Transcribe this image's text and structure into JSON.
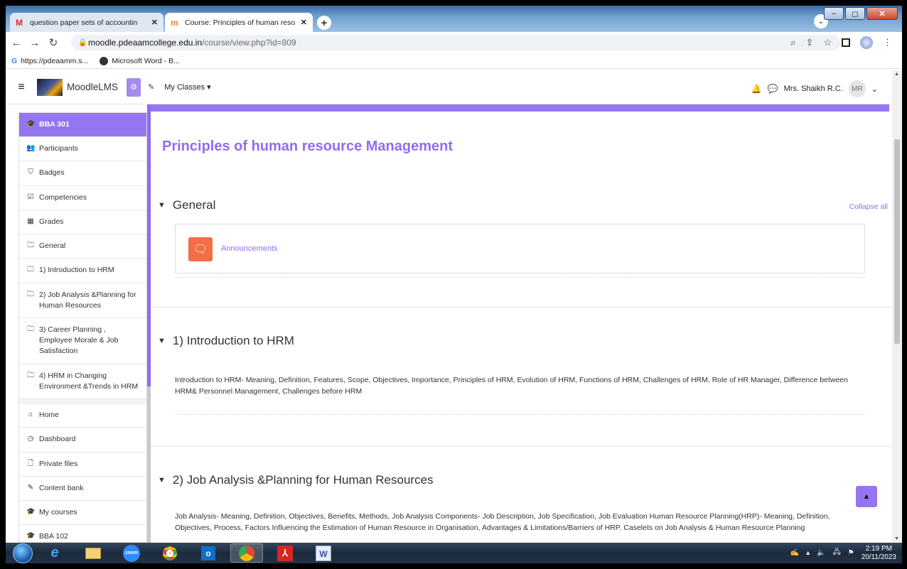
{
  "browser": {
    "tabs": [
      {
        "favicon": "gmail-icon",
        "title": "question paper sets of accountin"
      },
      {
        "favicon": "moodle-icon",
        "title": "Course: Principles of human reso"
      }
    ],
    "new_tab_label": "+",
    "close_glyph": "✕",
    "url_domain": "moodle.pdeaamcollege.edu.in",
    "url_path": "/course/view.php?id=809",
    "bookmarks": [
      {
        "icon": "google-icon",
        "label": "https://pdeaamm.s..."
      },
      {
        "icon": "web-icon",
        "label": "Microsoft Word - B..."
      }
    ]
  },
  "navbar": {
    "brand": "MoodleLMS",
    "my_classes": "My Classes ▾",
    "user_name": "Mrs. Shaikh R.C.",
    "user_initials": "MR",
    "caret": "⌄"
  },
  "drawer": {
    "course_items": [
      {
        "icon": "graduation-cap-icon",
        "glyph": "🎓",
        "label": "BBA 301",
        "active": true
      },
      {
        "icon": "users-icon",
        "glyph": "👥",
        "label": "Participants"
      },
      {
        "icon": "shield-icon",
        "glyph": "⛉",
        "label": "Badges"
      },
      {
        "icon": "checkbox-icon",
        "glyph": "☑",
        "label": "Competencies"
      },
      {
        "icon": "table-icon",
        "glyph": "▦",
        "label": "Grades"
      },
      {
        "icon": "folder-icon",
        "glyph": "🗀",
        "label": "General"
      },
      {
        "icon": "folder-icon",
        "glyph": "🗀",
        "label": "1) Introduction to HRM"
      },
      {
        "icon": "folder-icon",
        "glyph": "🗀",
        "label": "2) Job Analysis &Planning for Human Resources"
      },
      {
        "icon": "folder-icon",
        "glyph": "🗀",
        "label": "3) Career Planning , Employee Morale & Job Satisfaction"
      },
      {
        "icon": "folder-icon",
        "glyph": "🗀",
        "label": "4) HRM in Changing Environment &Trends in HRM"
      }
    ],
    "site_items": [
      {
        "icon": "home-icon",
        "glyph": "⌂",
        "label": "Home"
      },
      {
        "icon": "dashboard-icon",
        "glyph": "◷",
        "label": "Dashboard"
      },
      {
        "icon": "file-icon",
        "glyph": "🗋",
        "label": "Private files"
      },
      {
        "icon": "brush-icon",
        "glyph": "✎",
        "label": "Content bank"
      },
      {
        "icon": "graduation-cap-icon",
        "glyph": "🎓",
        "label": "My courses"
      },
      {
        "icon": "graduation-cap-icon",
        "glyph": "🎓",
        "label": "BBA 102"
      }
    ]
  },
  "main": {
    "course_title": "Principles of human resource Management",
    "collapse_all": "Collapse all",
    "sections": [
      {
        "title": "General",
        "activity": "Announcements"
      },
      {
        "title": "1) Introduction to HRM",
        "summary": "Introduction to HRM- Meaning, Definition, Features, Scope, Objectives, Importance, Principles of HRM, Evolution of HRM, Functions of HRM, Challenges of HRM, Role of HR Manager, Difference between HRM& Personnel Management, Challenges before HRM"
      },
      {
        "title": "2) Job Analysis &Planning for Human Resources",
        "summary": "Job Analysis- Meaning, Definition, Objectives, Benefits, Methods, Job Analysis Components- Job Description, Job Specification, Job Evaluation Human Resource Planning(HRP)- Meaning, Definition, Objectives, Process, Factors Influencing the Estimation of Human Resource in Organisation, Advantages & Limitations/Barriers of HRP. Caselets on Job Analysis & Human Resource Planning"
      }
    ]
  },
  "taskbar": {
    "apps": [
      "start-orb",
      "internet-explorer-icon",
      "file-explorer-icon",
      "zoom-icon",
      "chrome-icon",
      "outlook-icon",
      "chrome-profile-icon",
      "acrobat-icon",
      "word-icon"
    ],
    "zoom_label": "zoom",
    "time": "2:19 PM",
    "date": "20/11/2023"
  },
  "colors": {
    "accent": "#9575f0",
    "title": "#8f6df0",
    "announcement_icon": "#f16e47"
  }
}
